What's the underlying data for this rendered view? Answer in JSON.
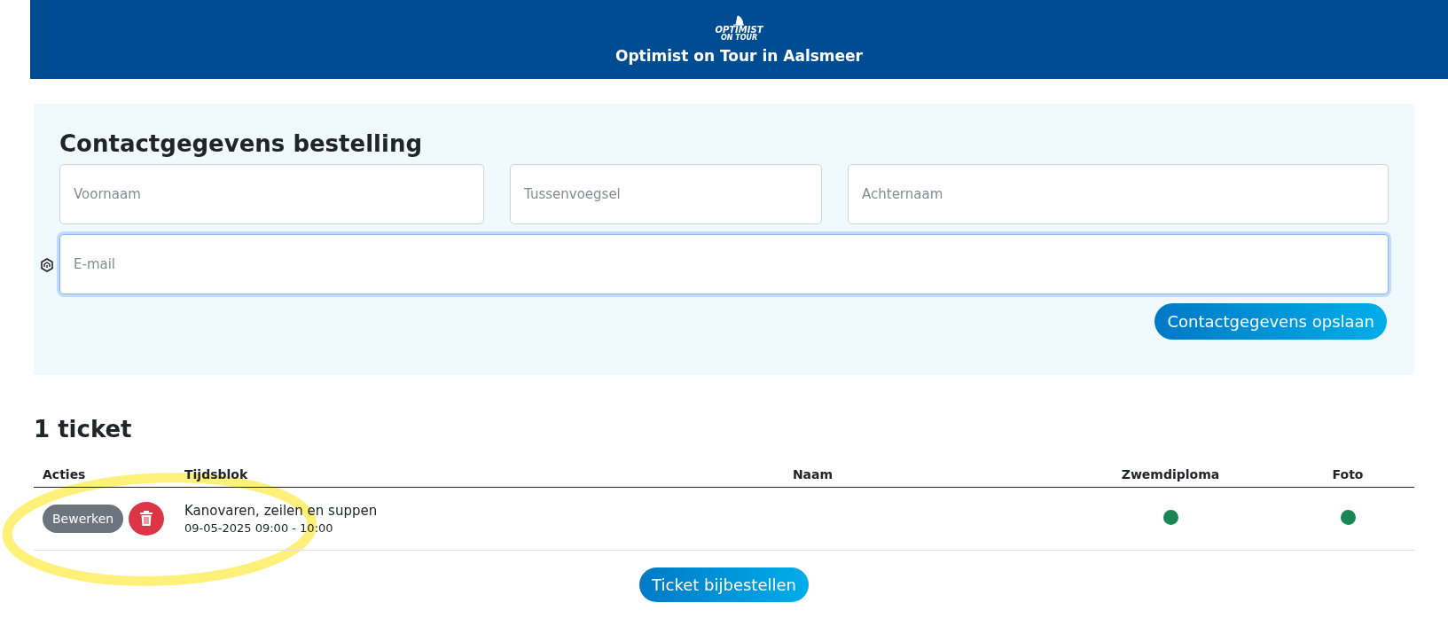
{
  "header": {
    "logo_line_1": "OPTIMIST",
    "logo_line_2": "ON TOUR",
    "title": "Optimist on Tour in Aalsmeer"
  },
  "contact": {
    "heading": "Contactgegevens bestelling",
    "fields": [
      {
        "placeholder": "Voornaam",
        "focused": false
      },
      {
        "placeholder": "Tussenvoegsel",
        "focused": false
      },
      {
        "placeholder": "Achternaam",
        "focused": false
      },
      {
        "placeholder": "E-mail",
        "focused": true
      }
    ],
    "save_button": "Contactgegevens opslaan"
  },
  "tickets": {
    "heading": "1 ticket",
    "columns": [
      "Acties",
      "Tijdsblok",
      "Naam",
      "Zwemdiploma",
      "Foto"
    ],
    "rows": [
      {
        "edit_button": "Bewerken",
        "activity": "Kanovaren, zeilen en suppen",
        "time": "09-05-2025 09:00 - 10:00",
        "zwemdiploma": true,
        "foto": true
      }
    ],
    "order_button": "Ticket bijbestellen"
  }
}
